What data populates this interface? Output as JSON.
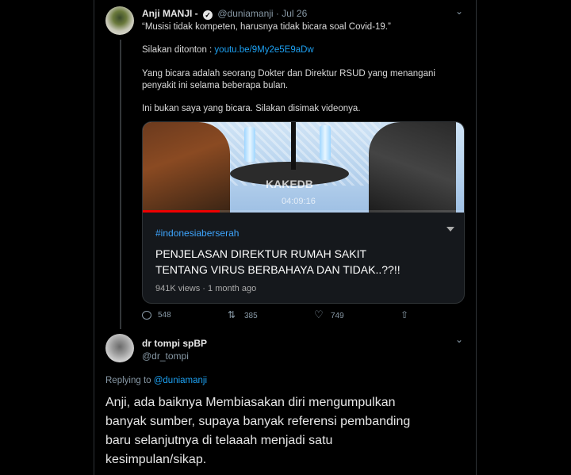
{
  "tweet1": {
    "name": "Anji MANJI -",
    "handle": "@duniamanji",
    "date": "· Jul 26",
    "line1": "“Musisi tidak kompeten, harusnya tidak bicara soal Covid-19.”",
    "line2_prefix": "Silakan ditonton : ",
    "line2_link": "youtu.be/9My2e5E9aDw",
    "line3a": "Yang bicara adalah seorang Dokter dan Direktur RSUD yang menangani",
    "line3b": "penyakit ini selama beberapa bulan.",
    "line4": "Ini bukan saya yang bicara. Silakan disimak videonya.",
    "actions": {
      "reply_count": "548",
      "retweet_count": "385",
      "like_count": "749"
    }
  },
  "video_card": {
    "watermark": "KAKEDB",
    "timecode": "04:09:16",
    "progress": 0.24,
    "hashtag": "#indonesiaberserah",
    "title_line1": "PENJELASAN DIREKTUR RUMAH SAKIT",
    "title_line2": "TENTANG VIRUS BERBAHAYA DAN TIDAK..??!!",
    "meta": "941K views · 1 month ago"
  },
  "tweet2": {
    "name": "dr tompi spBP",
    "handle": "@dr_tompi",
    "replying_prefix": "Replying to ",
    "replying_handle": "@duniamanji",
    "text_line1": "Anji, ada baiknya Membiasakan diri mengumpulkan",
    "text_line2": "banyak sumber, supaya banyak referensi pembanding",
    "text_line3": "baru selanjutnya di telaaah menjadi satu",
    "text_line4": "kesimpulan/sikap."
  },
  "icons": {
    "verified": "✓",
    "more": "⌄"
  },
  "colors": {
    "link": "#1da1f2",
    "secondary": "#8899a6",
    "progress": "#ee0000"
  }
}
